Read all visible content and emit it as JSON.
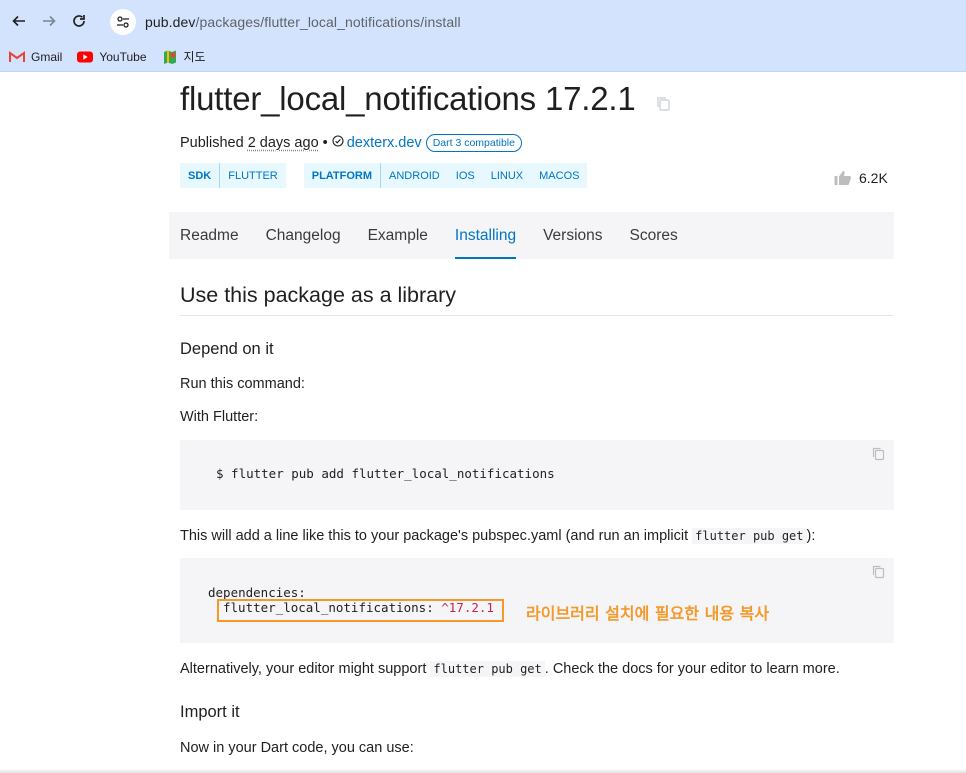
{
  "browser": {
    "url_host": "pub.dev",
    "url_path": "/packages/flutter_local_notifications/install",
    "bookmarks": [
      {
        "label": "Gmail",
        "icon": "gmail-icon"
      },
      {
        "label": "YouTube",
        "icon": "youtube-icon"
      },
      {
        "label": "지도",
        "icon": "maps-icon"
      }
    ]
  },
  "package": {
    "title": "flutter_local_notifications 17.2.1",
    "published_prefix": "Published",
    "published_ago": "2 days ago",
    "bullet": "•",
    "publisher": "dexterx.dev",
    "dart3_badge": "Dart 3 compatible",
    "sdk_tags": {
      "head": "SDK",
      "items": [
        "FLUTTER"
      ]
    },
    "platform_tags": {
      "head": "PLATFORM",
      "items": [
        "ANDROID",
        "IOS",
        "LINUX",
        "MACOS"
      ]
    },
    "likes": "6.2K"
  },
  "tabs": [
    {
      "label": "Readme",
      "active": false
    },
    {
      "label": "Changelog",
      "active": false
    },
    {
      "label": "Example",
      "active": false
    },
    {
      "label": "Installing",
      "active": true
    },
    {
      "label": "Versions",
      "active": false
    },
    {
      "label": "Scores",
      "active": false
    }
  ],
  "content": {
    "heading": "Use this package as a library",
    "depend_heading": "Depend on it",
    "run_command": "Run this command:",
    "with_flutter": "With Flutter:",
    "command": "$ flutter pub add flutter_local_notifications",
    "pubspec_pre": "This will add a line like this to your package's pubspec.yaml (and run an implicit",
    "pubspec_code": "flutter pub get",
    "pubspec_post": "):",
    "dep_line1": "dependencies:",
    "dep_key": "flutter_local_notifications:",
    "dep_version": "^17.2.1",
    "annotation": "라이브러리 설치에 필요한 내용 복사",
    "alt_pre": "Alternatively, your editor might support",
    "alt_code": "flutter pub get",
    "alt_post": ". Check the docs for your editor to learn more.",
    "import_heading": "Import it",
    "import_text": "Now in your Dart code, you can use:"
  },
  "colors": {
    "accent": "#0175c2",
    "annotation": "#f39a2b",
    "chrome": "#d3e3fd"
  }
}
